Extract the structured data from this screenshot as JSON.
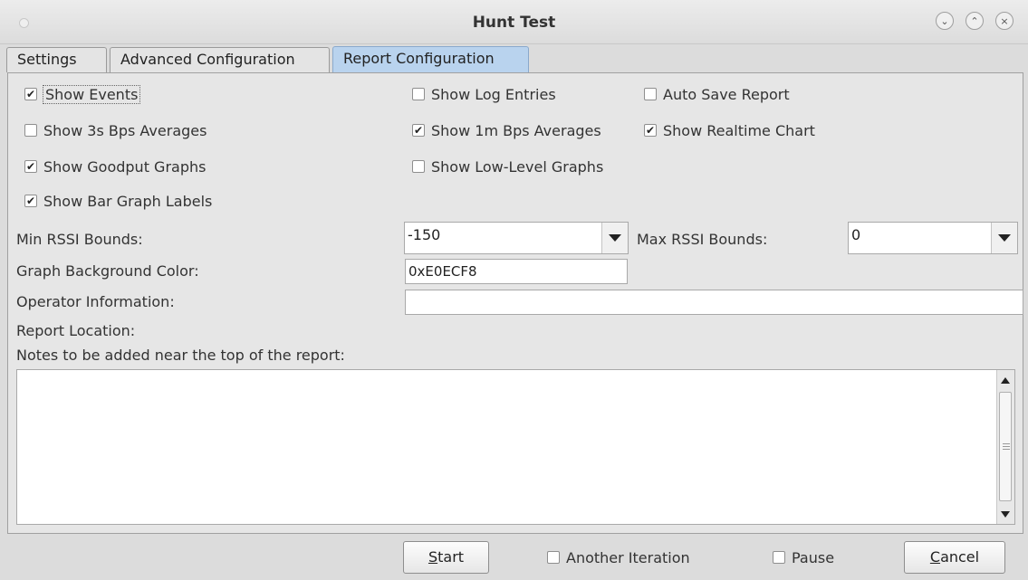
{
  "window": {
    "title": "Hunt Test",
    "controls": {
      "minimize": "⌄",
      "maximize": "⌃",
      "close": "×"
    }
  },
  "tabs": [
    {
      "label": "Settings",
      "active": false
    },
    {
      "label": "Advanced Configuration",
      "active": false
    },
    {
      "label": "Report Configuration",
      "active": true
    }
  ],
  "checkboxes": {
    "show_events": {
      "label": "Show Events",
      "checked": true
    },
    "show_log_entries": {
      "label": "Show Log Entries",
      "checked": false
    },
    "auto_save_report": {
      "label": "Auto Save Report",
      "checked": false
    },
    "show_3s_bps": {
      "label": "Show 3s Bps Averages",
      "checked": false
    },
    "show_1m_bps": {
      "label": "Show 1m Bps Averages",
      "checked": true
    },
    "show_realtime_chart": {
      "label": "Show Realtime Chart",
      "checked": true
    },
    "show_goodput_graphs": {
      "label": "Show Goodput Graphs",
      "checked": true
    },
    "show_low_level_graphs": {
      "label": "Show Low-Level Graphs",
      "checked": false
    },
    "show_bar_graph_labels": {
      "label": "Show Bar Graph Labels",
      "checked": true
    }
  },
  "fields": {
    "min_rssi": {
      "label": "Min RSSI Bounds:",
      "value": "-150"
    },
    "max_rssi": {
      "label": "Max RSSI Bounds:",
      "value": "0"
    },
    "graph_bg_color": {
      "label": "Graph Background Color:",
      "value": "0xE0ECF8"
    },
    "operator_info": {
      "label": "Operator Information:",
      "value": ""
    },
    "report_location": {
      "label": "Report Location:"
    },
    "notes": {
      "label": "Notes to be added near the top of the report:",
      "value": ""
    }
  },
  "bottom": {
    "start_pre": "",
    "start_mnemonic": "S",
    "start_post": "tart",
    "another_iteration": {
      "label": "Another Iteration",
      "checked": false
    },
    "pause": {
      "label": "Pause",
      "checked": false
    },
    "cancel_mnemonic": "C",
    "cancel_post": "ancel"
  },
  "colors": {
    "active_tab": "#b9d3ee",
    "background": "#dcdcdc"
  }
}
